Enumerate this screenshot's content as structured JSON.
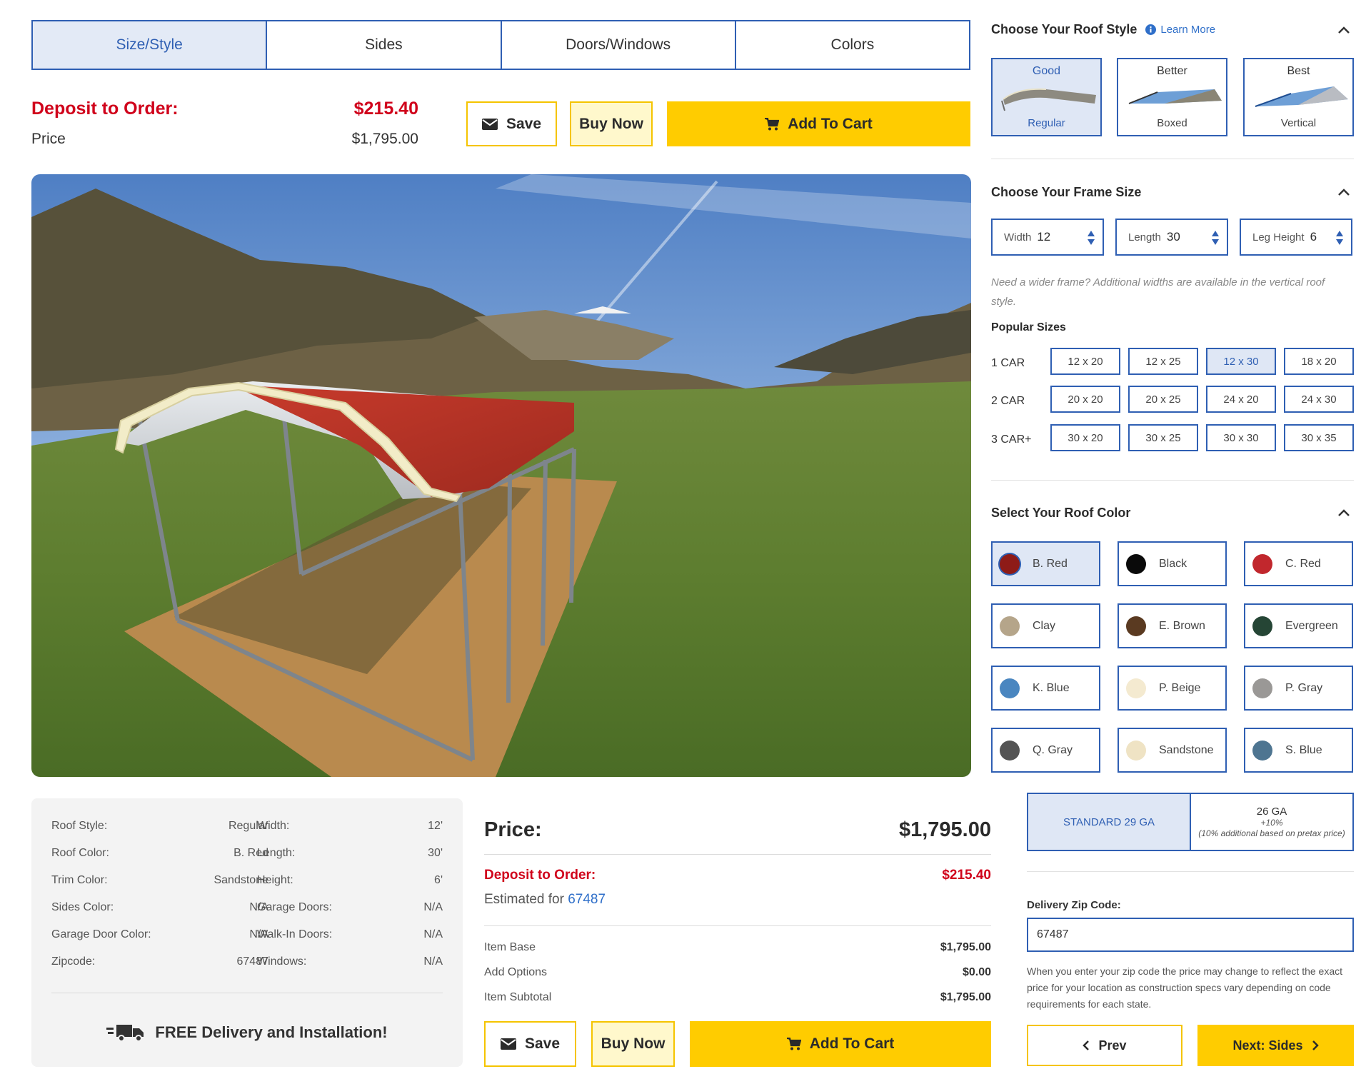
{
  "tabs": [
    {
      "label": "Size/Style",
      "active": true
    },
    {
      "label": "Sides",
      "active": false
    },
    {
      "label": "Doors/Windows",
      "active": false
    },
    {
      "label": "Colors",
      "active": false
    }
  ],
  "top": {
    "deposit_label": "Deposit to Order:",
    "deposit_value": "$215.40",
    "price_label": "Price",
    "price_value": "$1,795.00",
    "save_label": "Save",
    "buy_label": "Buy Now",
    "cart_label": "Add To Cart"
  },
  "summary": {
    "left": [
      {
        "label": "Roof Style:",
        "value": "Regular"
      },
      {
        "label": "Roof Color:",
        "value": "B. Red"
      },
      {
        "label": "Trim Color:",
        "value": "Sandstone"
      },
      {
        "label": "Sides Color:",
        "value": "N/A"
      },
      {
        "label": "Garage Door Color:",
        "value": "N/A"
      },
      {
        "label": "Zipcode:",
        "value": "67487"
      }
    ],
    "right": [
      {
        "label": "Width:",
        "value": "12'"
      },
      {
        "label": "Length:",
        "value": "30'"
      },
      {
        "label": "Height:",
        "value": "6'"
      },
      {
        "label": "Garage Doors:",
        "value": "N/A"
      },
      {
        "label": "Walk-In Doors:",
        "value": "N/A"
      },
      {
        "label": "Windows:",
        "value": "N/A"
      }
    ],
    "delivery_text": "FREE Delivery and Installation!"
  },
  "price_panel": {
    "title": "Price:",
    "total": "$1,795.00",
    "deposit_label": "Deposit to Order:",
    "deposit_value": "$215.40",
    "estimated_prefix": "Estimated for",
    "estimated_zip": "67487",
    "lines": [
      {
        "label": "Item Base",
        "value": "$1,795.00"
      },
      {
        "label": "Add Options",
        "value": "$0.00"
      },
      {
        "label": "Item Subtotal",
        "value": "$1,795.00"
      }
    ],
    "save_label": "Save",
    "buy_label": "Buy Now",
    "cart_label": "Add To Cart"
  },
  "sidebar": {
    "roof_style": {
      "title": "Choose Your Roof Style",
      "learn_more": "Learn More",
      "options": [
        {
          "tier": "Good",
          "name": "Regular",
          "active": true
        },
        {
          "tier": "Better",
          "name": "Boxed",
          "active": false
        },
        {
          "tier": "Best",
          "name": "Vertical",
          "active": false
        }
      ]
    },
    "frame_size": {
      "title": "Choose Your Frame Size",
      "width_label": "Width",
      "width_value": "12",
      "length_label": "Length",
      "length_value": "30",
      "leg_label": "Leg Height",
      "leg_value": "6",
      "note": "Need a wider frame? Additional widths are available in the vertical roof style.",
      "popular_title": "Popular Sizes",
      "rows": [
        {
          "label": "1 CAR",
          "sizes": [
            "12 x 20",
            "12 x 25",
            "12 x 30",
            "18 x 20"
          ]
        },
        {
          "label": "2 CAR",
          "sizes": [
            "20 x 20",
            "20 x 25",
            "24 x 20",
            "24 x 30"
          ]
        },
        {
          "label": "3 CAR+",
          "sizes": [
            "30 x 20",
            "30 x 25",
            "30 x 30",
            "30 x 35"
          ]
        }
      ],
      "selected": "12 x 30"
    },
    "roof_color": {
      "title": "Select Your Roof Color",
      "colors": [
        {
          "name": "B. Red",
          "hex": "#8e1b17",
          "active": true
        },
        {
          "name": "Black",
          "hex": "#0a0a0a",
          "active": false
        },
        {
          "name": "C. Red",
          "hex": "#c1272d",
          "active": false
        },
        {
          "name": "Clay",
          "hex": "#b5a58a",
          "active": false
        },
        {
          "name": "E. Brown",
          "hex": "#5a3a21",
          "active": false
        },
        {
          "name": "Evergreen",
          "hex": "#254535",
          "active": false
        },
        {
          "name": "K. Blue",
          "hex": "#4a86c0",
          "active": false
        },
        {
          "name": "P. Beige",
          "hex": "#f4ead0",
          "active": false
        },
        {
          "name": "P. Gray",
          "hex": "#9a9896",
          "active": false
        },
        {
          "name": "Q. Gray",
          "hex": "#545454",
          "active": false
        },
        {
          "name": "Sandstone",
          "hex": "#efe3c4",
          "active": false
        },
        {
          "name": "S. Blue",
          "hex": "#4e7591",
          "active": false
        }
      ]
    },
    "gauge": {
      "standard_label": "STANDARD 29 GA",
      "alt_label": "26 GA",
      "alt_pct": "+10%",
      "alt_note": "(10% additional based on pretax price)"
    },
    "zip": {
      "label": "Delivery Zip Code:",
      "value": "67487",
      "note": "When you enter your zip code the price may change to reflect the exact price for your location as construction specs vary depending on code requirements for each state."
    },
    "nav": {
      "prev_label": "Prev",
      "next_label": "Next: Sides"
    }
  },
  "theme": {
    "accent": "#2f5fb3",
    "deposit_red": "#d0021b",
    "button_yellow": "#ffcc00",
    "link_blue": "#2f6fc9"
  }
}
